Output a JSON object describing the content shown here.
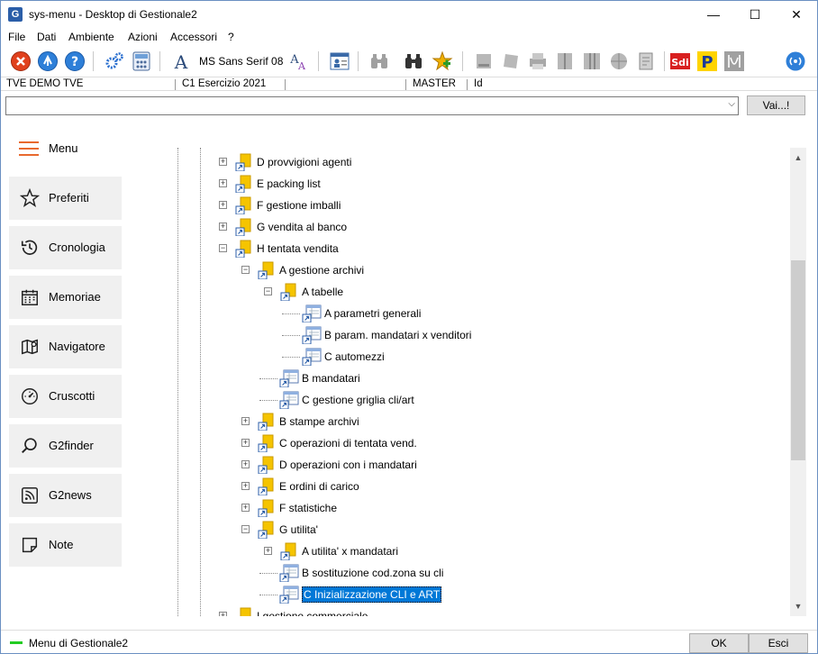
{
  "window": {
    "title": "sys-menu - Desktop di Gestionale2",
    "app_icon_letter": "G",
    "minimize": "—",
    "maximize": "☐",
    "close": "✕"
  },
  "menubar": [
    "File",
    "Dati",
    "Ambiente",
    "Azioni",
    "Accessori",
    "?"
  ],
  "toolbar": {
    "font_label": "MS Sans Serif 08",
    "icons": [
      "close-circle-icon",
      "navigate-icon",
      "help-icon",
      "settings-gears-icon",
      "calculator-icon",
      "font-icon",
      "font-size-icon",
      "user-card-icon",
      "binoculars-gray-icon",
      "binoculars-icon",
      "star-add-icon",
      "sdi-icon",
      "p-icon",
      "waveform-icon",
      "wireless-icon"
    ]
  },
  "statusline": {
    "company": "TVE DEMO TVE",
    "exercise": "C1 Esercizio 2021",
    "user": "MASTER",
    "id_label": "Id"
  },
  "search": {
    "value": "",
    "go_button": "Vai...!"
  },
  "sidebar": {
    "menu_label": "Menu",
    "items": [
      {
        "label": "Preferiti",
        "icon": "star-icon"
      },
      {
        "label": "Cronologia",
        "icon": "history-icon"
      },
      {
        "label": "Memoriae",
        "icon": "calendar-icon"
      },
      {
        "label": "Navigatore",
        "icon": "map-icon"
      },
      {
        "label": "Cruscotti",
        "icon": "gauge-icon"
      },
      {
        "label": "G2finder",
        "icon": "search-icon"
      },
      {
        "label": "G2news",
        "icon": "rss-icon"
      },
      {
        "label": "Note",
        "icon": "note-icon"
      }
    ]
  },
  "tree": [
    {
      "label": "D provvigioni agenti",
      "level": 0,
      "type": "folder",
      "expanded": false
    },
    {
      "label": "E packing list",
      "level": 0,
      "type": "folder",
      "expanded": false
    },
    {
      "label": "F gestione imballi",
      "level": 0,
      "type": "folder",
      "expanded": false
    },
    {
      "label": "G vendita al banco",
      "level": 0,
      "type": "folder",
      "expanded": false
    },
    {
      "label": "H tentata vendita",
      "level": 0,
      "type": "folder",
      "expanded": true
    },
    {
      "label": "A gestione archivi",
      "level": 1,
      "type": "folder",
      "expanded": true
    },
    {
      "label": "A tabelle",
      "level": 2,
      "type": "folder",
      "expanded": true
    },
    {
      "label": "A parametri generali",
      "level": 3,
      "type": "program"
    },
    {
      "label": "B param. mandatari x venditori",
      "level": 3,
      "type": "program"
    },
    {
      "label": "C automezzi",
      "level": 3,
      "type": "program"
    },
    {
      "label": "B mandatari",
      "level": 2,
      "type": "program"
    },
    {
      "label": "C gestione griglia cli/art",
      "level": 2,
      "type": "program"
    },
    {
      "label": "B stampe archivi",
      "level": 1,
      "type": "folder",
      "expanded": false
    },
    {
      "label": "C operazioni di tentata vend.",
      "level": 1,
      "type": "folder",
      "expanded": false
    },
    {
      "label": "D operazioni con i mandatari",
      "level": 1,
      "type": "folder",
      "expanded": false
    },
    {
      "label": "E ordini di carico",
      "level": 1,
      "type": "folder",
      "expanded": false
    },
    {
      "label": "F statistiche",
      "level": 1,
      "type": "folder",
      "expanded": false
    },
    {
      "label": "G utilita'",
      "level": 1,
      "type": "folder",
      "expanded": true
    },
    {
      "label": "A utilita' x mandatari",
      "level": 2,
      "type": "folder",
      "expanded": false
    },
    {
      "label": "B sostituzione cod.zona su cli",
      "level": 2,
      "type": "program"
    },
    {
      "label": "C Inizializzazione CLI e ART",
      "level": 2,
      "type": "program",
      "selected": true
    },
    {
      "label": "I gestione commerciale",
      "level": 0,
      "type": "folder",
      "expanded": false
    }
  ],
  "bottom": {
    "status": "Menu di Gestionale2",
    "ok_button": "OK",
    "exit_button": "Esci"
  },
  "colors": {
    "accent_orange": "#e8692e",
    "selection_blue": "#0078d7",
    "folder_yellow": "#f5c400",
    "status_green": "#22cc22"
  }
}
